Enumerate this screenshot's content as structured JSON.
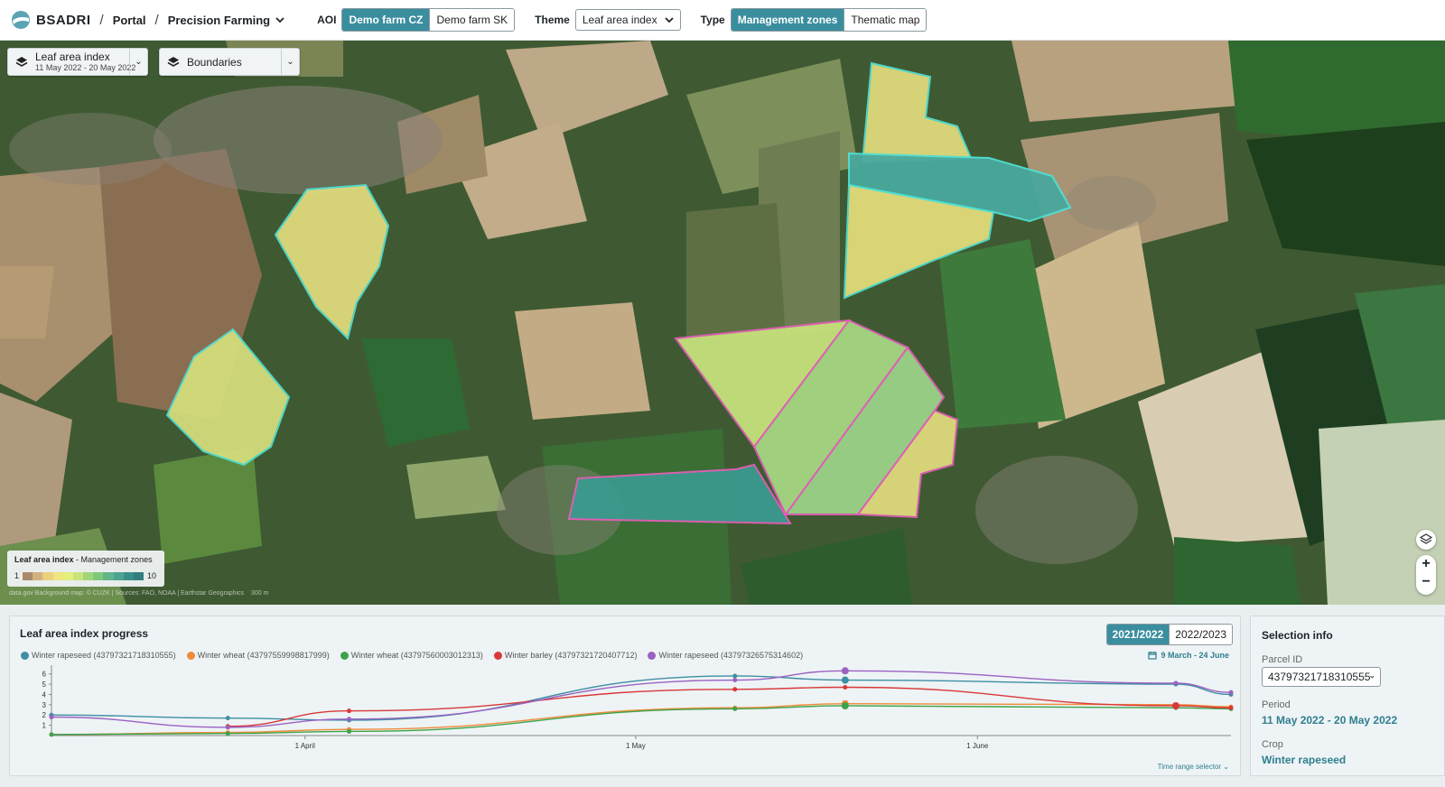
{
  "header": {
    "brand": "BSADRI",
    "crumb_portal": "Portal",
    "crumb_app": "Precision Farming",
    "aoi_label": "AOI",
    "aoi_options": [
      "Demo farm CZ",
      "Demo farm SK"
    ],
    "theme_label": "Theme",
    "theme_value": "Leaf area index",
    "type_label": "Type",
    "type_options": [
      "Management zones",
      "Thematic map"
    ]
  },
  "map": {
    "layer_title": "Leaf area index",
    "layer_dates": "11 May 2022 - 20 May 2022",
    "boundaries_label": "Boundaries",
    "legend_title": "Leaf area index",
    "legend_subtitle": " - Management zones",
    "legend_min": "1",
    "legend_max": "10",
    "legend_colors": [
      "#a98a6a",
      "#d3b07f",
      "#e8d27d",
      "#f0e57e",
      "#e5ef7e",
      "#c8e47a",
      "#a0d67a",
      "#7ec87a",
      "#62b48a",
      "#4ea393",
      "#3a8e8a",
      "#2f7f7f"
    ],
    "attribution": "data.gov Background map: © CUZK | Sources: FAO, NOAA | Earthstar Geographics",
    "scale": "300 m"
  },
  "chart_panel": {
    "title": "Leaf area index progress",
    "years": [
      "2021/2022",
      "2022/2023"
    ],
    "date_range": "9 March - 24 June",
    "time_range_selector": "Time range selector"
  },
  "chart_data": {
    "type": "line",
    "x": [
      "2022-03-09",
      "2022-03-25",
      "2022-04-05",
      "2022-05-10",
      "2022-05-20",
      "2022-06-19",
      "2022-06-24"
    ],
    "series": [
      {
        "name": "Winter rapeseed (43797321718310555)",
        "color": "#3e8fa3",
        "values": [
          2.0,
          1.7,
          1.5,
          5.8,
          5.4,
          5.0,
          4.0
        ]
      },
      {
        "name": "Winter wheat (43797559998817999)",
        "color": "#f08b3a",
        "values": [
          0.1,
          0.3,
          0.6,
          2.7,
          3.1,
          3.0,
          2.8
        ]
      },
      {
        "name": "Winter wheat (43797560003012313)",
        "color": "#3da34a",
        "values": [
          0.1,
          0.2,
          0.4,
          2.6,
          2.9,
          2.7,
          2.6
        ]
      },
      {
        "name": "Winter barley (43797321720407712)",
        "color": "#d9393a",
        "values": [
          null,
          0.9,
          2.4,
          4.5,
          4.7,
          2.9,
          2.7
        ]
      },
      {
        "name": "Winter rapeseed (43797326575314602)",
        "color": "#9a62c2",
        "values": [
          1.8,
          0.8,
          1.6,
          5.4,
          6.3,
          5.1,
          4.2
        ]
      }
    ],
    "y_ticks": [
      "1",
      "2",
      "3",
      "4",
      "5",
      "6"
    ],
    "ylim": [
      0,
      6.5
    ],
    "x_tick_labels": [
      "1 April",
      "1 May",
      "1 June"
    ],
    "x_tick_dates": [
      "2022-04-01",
      "2022-05-01",
      "2022-06-01"
    ]
  },
  "selection_info": {
    "title": "Selection info",
    "parcel_label": "Parcel ID",
    "parcel_value": "43797321718310555",
    "period_label": "Period",
    "period_value": "11 May 2022 - 20 May 2022",
    "crop_label": "Crop",
    "crop_value": "Winter rapeseed"
  }
}
